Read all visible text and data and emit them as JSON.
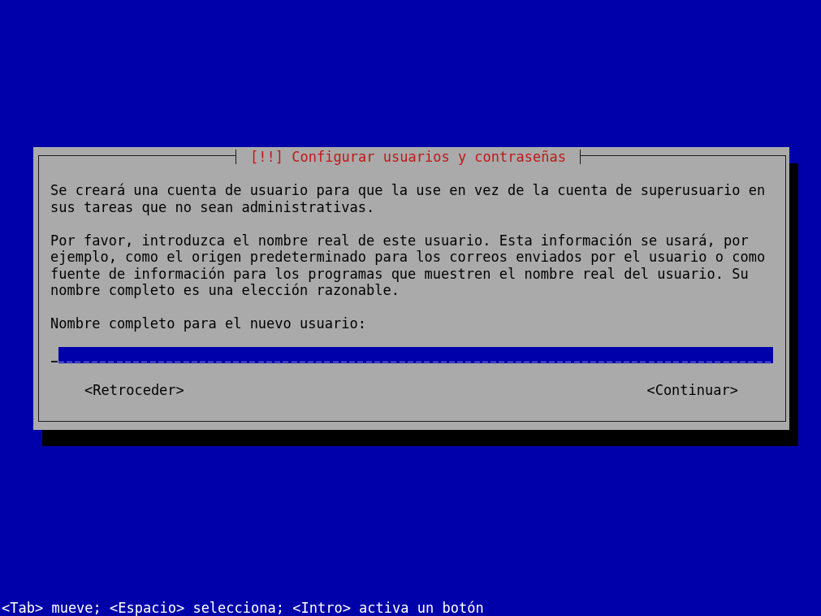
{
  "dialog": {
    "title": "[!!] Configurar usuarios y contraseñas",
    "paragraphs": [
      "Se creará una cuenta de usuario para que la use en vez de la cuenta de superusuario en sus tareas que no sean administrativas.",
      "Por favor, introduzca el nombre real de este usuario. Esta información se usará, por ejemplo, como el origen predeterminado para los correos enviados por el usuario o como fuente de información para los programas que muestren el nombre real del usuario. Su nombre completo es una elección razonable."
    ],
    "field": {
      "label": "Nombre completo para el nuevo usuario:",
      "focused": true
    },
    "buttons": [
      "<Retroceder>",
      "<Continuar>"
    ]
  },
  "status_bar": {
    "text": "<Tab> mueve; <Espacio> selecciona; <Intro> activa un botón"
  }
}
